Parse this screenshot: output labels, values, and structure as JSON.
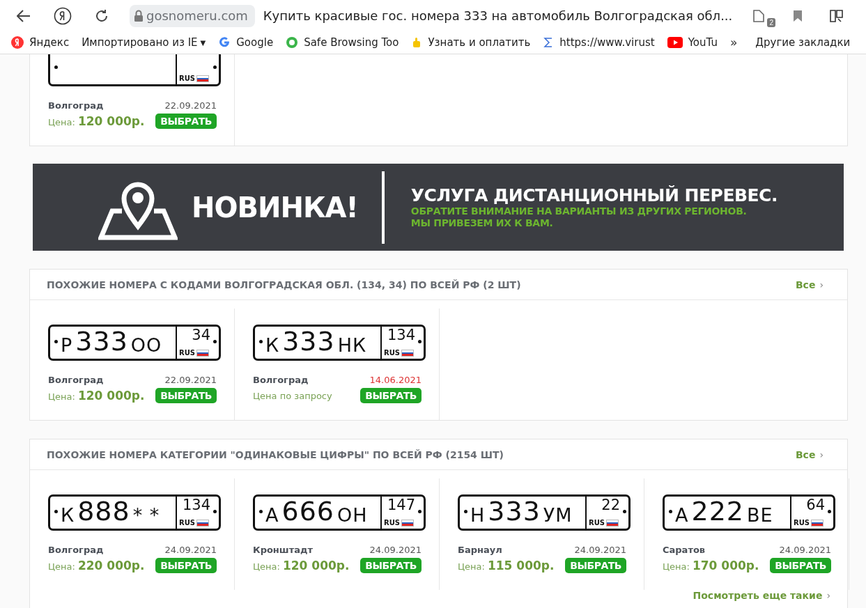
{
  "browser": {
    "url": "gosnomeru.com",
    "tab_title": "Купить красивые гос. номера 333 на автомобиль Волгоградская обл...",
    "extension_badge": "2"
  },
  "bookmarks": [
    {
      "kind": "yandex",
      "label": "Яндекс"
    },
    {
      "kind": "folder-menu",
      "label": "Импортировано из IE",
      "caret": "▼"
    },
    {
      "kind": "google",
      "label": "Google"
    },
    {
      "kind": "shield",
      "label": "Safe Browsing Too"
    },
    {
      "kind": "hand",
      "label": "Узнать и оплатить"
    },
    {
      "kind": "sigma",
      "label": "https://www.virust"
    },
    {
      "kind": "youtube",
      "label": "YouTu"
    }
  ],
  "bookmarks_more": "»",
  "other_bookmarks": "Другие закладки",
  "top_card": {
    "items": [
      {
        "plate": {
          "rus": "RUS"
        },
        "city": "Волгоград",
        "date": "22.09.2021",
        "date_stale": false,
        "kind": "price",
        "price_label": "Цена:",
        "price": "120 000р.",
        "button": "ВЫБРАТЬ"
      }
    ]
  },
  "banner": {
    "headline": "НОВИНКА!",
    "title": "УСЛУГА ДИСТАНЦИОННЫЙ ПЕРЕВЕС.",
    "lines": [
      "ОБРАТИТЕ ВНИМАНИЕ НА ВАРИАНТЫ ИЗ ДРУГИХ РЕГИОНОВ.",
      "МЫ ПРИВЕЗЕМ ИХ К ВАМ."
    ]
  },
  "sections": [
    {
      "title": "ПОХОЖИЕ НОМЕРА С КОДАМИ ВОЛГОГРАДСКАЯ ОБЛ. (134, 34) ПО ВСЕЙ РФ (2 ШТ)",
      "all_link": "Все",
      "all_chevron": "›",
      "items": [
        {
          "plate": {
            "series1": "Р",
            "digits": "333",
            "series2": "ОО",
            "region": "34",
            "rus": "RUS"
          },
          "city": "Волгоград",
          "date": "22.09.2021",
          "date_stale": false,
          "kind": "price",
          "price_label": "Цена:",
          "price": "120 000р.",
          "button": "ВЫБРАТЬ"
        },
        {
          "plate": {
            "series1": "К",
            "digits": "333",
            "series2": "НК",
            "region": "134",
            "rus": "RUS"
          },
          "city": "Волгоград",
          "date": "14.06.2021",
          "date_stale": true,
          "kind": "request",
          "price_text": "Цена по запросу",
          "button": "ВЫБРАТЬ"
        }
      ]
    },
    {
      "title": "ПОХОЖИЕ НОМЕРА КАТЕГОРИИ \"ОДИНАКОВЫЕ ЦИФРЫ\" ПО ВСЕЙ РФ (2154 ШТ)",
      "all_link": "Все",
      "all_chevron": "›",
      "more_link": "Посмотреть еще такие",
      "more_chevron": "›",
      "items": [
        {
          "plate": {
            "series1": "К",
            "digits": "888",
            "series2": "* *",
            "region": "134",
            "rus": "RUS"
          },
          "city": "Волгоград",
          "date": "24.09.2021",
          "date_stale": false,
          "kind": "price",
          "price_label": "Цена:",
          "price": "220 000р.",
          "button": "ВЫБРАТЬ"
        },
        {
          "plate": {
            "series1": "А",
            "digits": "666",
            "series2": "ОН",
            "region": "147",
            "rus": "RUS"
          },
          "city": "Кронштадт",
          "date": "24.09.2021",
          "date_stale": false,
          "kind": "price",
          "price_label": "Цена:",
          "price": "120 000р.",
          "button": "ВЫБРАТЬ"
        },
        {
          "plate": {
            "series1": "Н",
            "digits": "333",
            "series2": "УМ",
            "region": "22",
            "rus": "RUS"
          },
          "city": "Барнаул",
          "date": "24.09.2021",
          "date_stale": false,
          "kind": "price",
          "price_label": "Цена:",
          "price": "115 000р.",
          "button": "ВЫБРАТЬ"
        },
        {
          "plate": {
            "series1": "А",
            "digits": "222",
            "series2": "ВЕ",
            "region": "64",
            "rus": "RUS"
          },
          "city": "Саратов",
          "date": "24.09.2021",
          "date_stale": false,
          "kind": "price",
          "price_label": "Цена:",
          "price": "170 000р.",
          "button": "ВЫБРАТЬ"
        }
      ]
    }
  ]
}
